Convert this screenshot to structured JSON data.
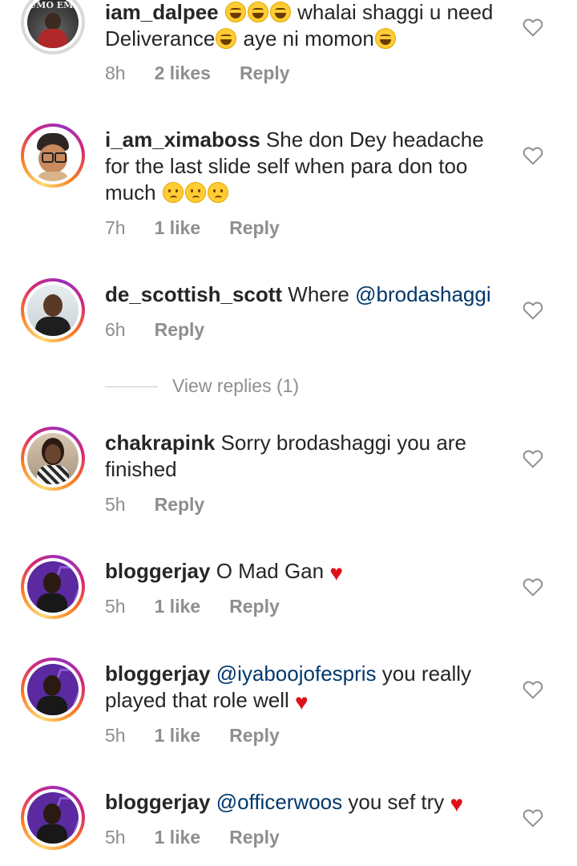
{
  "comments": [
    {
      "username": "iam_dalpee",
      "text_parts": [
        " ",
        "laugh",
        "laugh",
        "laugh",
        " whalai shaggi u need Deliverance",
        "laugh",
        " aye ni momon",
        "laugh"
      ],
      "time": "8h",
      "likes": "2 likes",
      "reply": "Reply",
      "avatar_caption": "UMO EMI"
    },
    {
      "username": "i_am_ximaboss",
      "text": " She don Dey headache for the last slide self when para don too much ",
      "emoji": "cry",
      "time": "7h",
      "likes": "1 like",
      "reply": "Reply"
    },
    {
      "username": "de_scottish_scott",
      "text": " Where ",
      "mention": "@brodashaggi",
      "time": "6h",
      "reply": "Reply",
      "view_replies": "View replies (1)"
    },
    {
      "username": "chakrapink",
      "text": " Sorry brodashaggi you are finished",
      "time": "5h",
      "reply": "Reply"
    },
    {
      "username": "bloggerjay",
      "text": " O Mad Gan ",
      "time": "5h",
      "likes": "1 like",
      "reply": "Reply"
    },
    {
      "username": "bloggerjay",
      "mention": "@iyaboojofespris",
      "text": " you really played that role well ",
      "time": "5h",
      "likes": "1 like",
      "reply": "Reply"
    },
    {
      "username": "bloggerjay",
      "mention": "@officerwoos",
      "text": " you sef try ",
      "time": "5h",
      "likes": "1 like",
      "reply": "Reply"
    }
  ],
  "colors": {
    "username": "#262626",
    "meta": "#8e8e8e",
    "mention": "#00376b",
    "heart_red": "#e0101a"
  }
}
